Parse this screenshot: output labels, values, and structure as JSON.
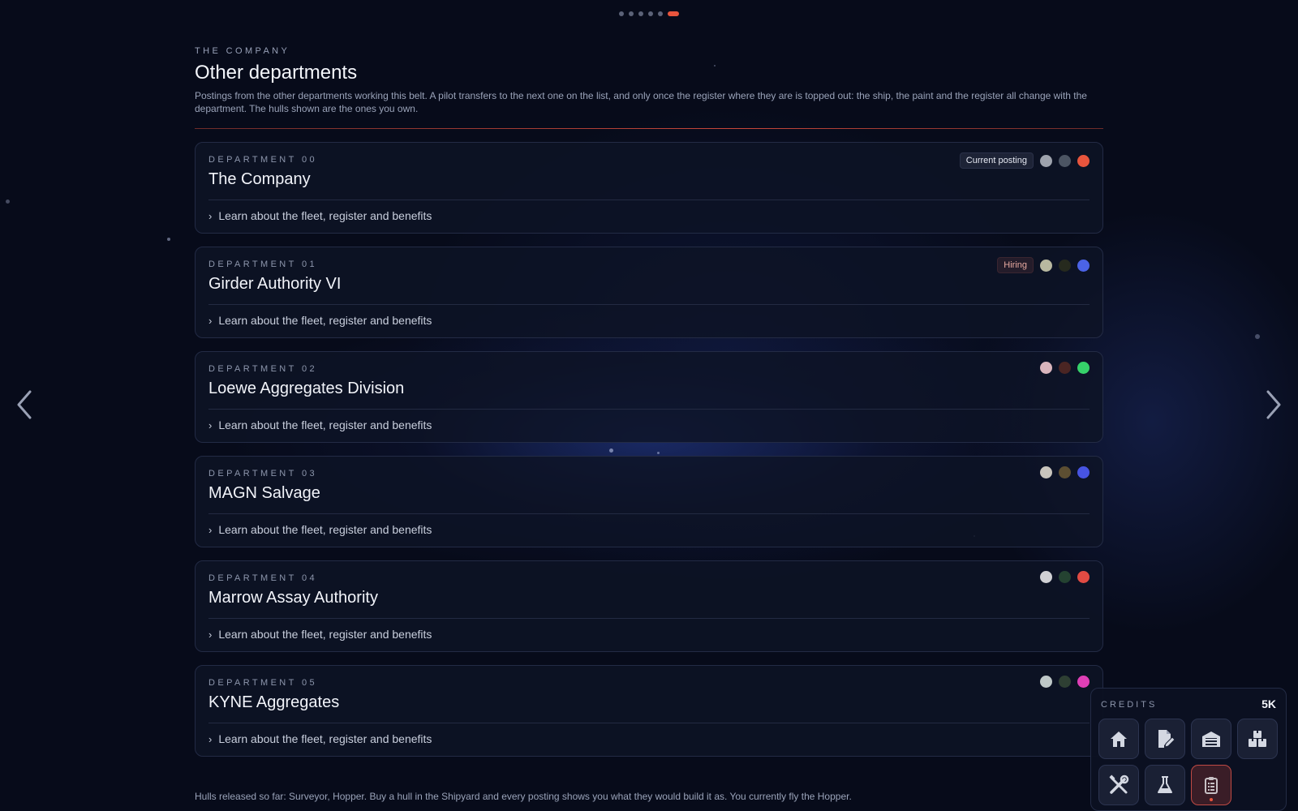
{
  "pager": {
    "count": 6,
    "active_index": 5
  },
  "header": {
    "eyebrow": "THE COMPANY",
    "title": "Other departments",
    "description": "Postings from the other departments working this belt. A pilot transfers to the next one on the list, and only once the register where they are is topped out: the ship, the paint and the register all change with the department. The hulls shown are the ones you own."
  },
  "departments": [
    {
      "number": "DEPARTMENT 00",
      "name": "The Company",
      "badge": "Current posting",
      "badge_type": "current",
      "swatches": [
        "#9ea3ad",
        "#4c5563",
        "#e8553d"
      ],
      "link": "Learn about the fleet, register and benefits"
    },
    {
      "number": "DEPARTMENT 01",
      "name": "Girder Authority VI",
      "badge": "Hiring",
      "badge_type": "hiring",
      "swatches": [
        "#b8b8a0",
        "#262a1e",
        "#4b63e6"
      ],
      "link": "Learn about the fleet, register and benefits"
    },
    {
      "number": "DEPARTMENT 02",
      "name": "Loewe Aggregates Division",
      "badge": "",
      "badge_type": "",
      "swatches": [
        "#d9b5bd",
        "#4a2523",
        "#36d26a"
      ],
      "link": "Learn about the fleet, register and benefits"
    },
    {
      "number": "DEPARTMENT 03",
      "name": "MAGN Salvage",
      "badge": "",
      "badge_type": "",
      "swatches": [
        "#c9c5bd",
        "#5c4e32",
        "#4754e3"
      ],
      "link": "Learn about the fleet, register and benefits"
    },
    {
      "number": "DEPARTMENT 04",
      "name": "Marrow Assay Authority",
      "badge": "",
      "badge_type": "",
      "swatches": [
        "#d0d0d4",
        "#244231",
        "#e14b43"
      ],
      "link": "Learn about the fleet, register and benefits"
    },
    {
      "number": "DEPARTMENT 05",
      "name": "KYNE Aggregates",
      "badge": "",
      "badge_type": "",
      "swatches": [
        "#bfc8c8",
        "#2e3f33",
        "#df3fb6"
      ],
      "link": "Learn about the fleet, register and benefits"
    }
  ],
  "footer": "Hulls released so far: Surveyor, Hopper. Buy a hull in the Shipyard and every posting shows you what they would build it as. You currently fly the Hopper.",
  "panel": {
    "label": "CREDITS",
    "value": "5K",
    "buttons": [
      {
        "icon": "home-icon"
      },
      {
        "icon": "edit-document-icon"
      },
      {
        "icon": "hangar-icon"
      },
      {
        "icon": "crates-icon"
      },
      {
        "icon": "tools-icon"
      },
      {
        "icon": "flask-icon"
      },
      {
        "icon": "clipboard-icon",
        "active": true
      }
    ]
  },
  "colors": {
    "accent": "#e8553d",
    "background": "#070b1a",
    "card_border": "#232b45"
  }
}
